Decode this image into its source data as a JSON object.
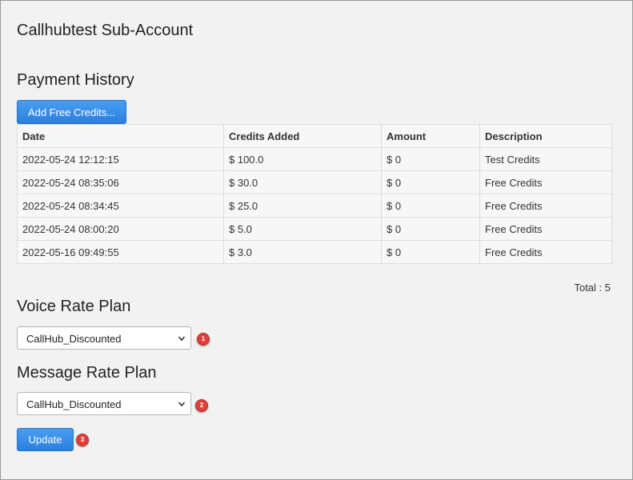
{
  "page_title": "Callhubtest Sub-Account",
  "payment_history": {
    "title": "Payment History",
    "add_button": "Add Free Credits...",
    "columns": [
      "Date",
      "Credits Added",
      "Amount",
      "Description"
    ],
    "rows": [
      [
        "2022-05-24 12:12:15",
        "$ 100.0",
        "$ 0",
        "Test Credits"
      ],
      [
        "2022-05-24 08:35:06",
        "$ 30.0",
        "$ 0",
        "Free Credits"
      ],
      [
        "2022-05-24 08:34:45",
        "$ 25.0",
        "$ 0",
        "Free Credits"
      ],
      [
        "2022-05-24 08:00:20",
        "$ 5.0",
        "$ 0",
        "Free Credits"
      ],
      [
        "2022-05-16 09:49:55",
        "$ 3.0",
        "$ 0",
        "Free Credits"
      ]
    ],
    "total": "Total : 5"
  },
  "voice_rate_plan": {
    "title": "Voice Rate Plan",
    "selected": "CallHub_Discounted",
    "marker": "1"
  },
  "message_rate_plan": {
    "title": "Message Rate Plan",
    "selected": "CallHub_Discounted",
    "marker": "2"
  },
  "update_button": {
    "label": "Update",
    "marker": "3"
  },
  "colors": {
    "button": "#2a7fe0",
    "marker": "#e0403a",
    "background": "#f2f2f2"
  }
}
